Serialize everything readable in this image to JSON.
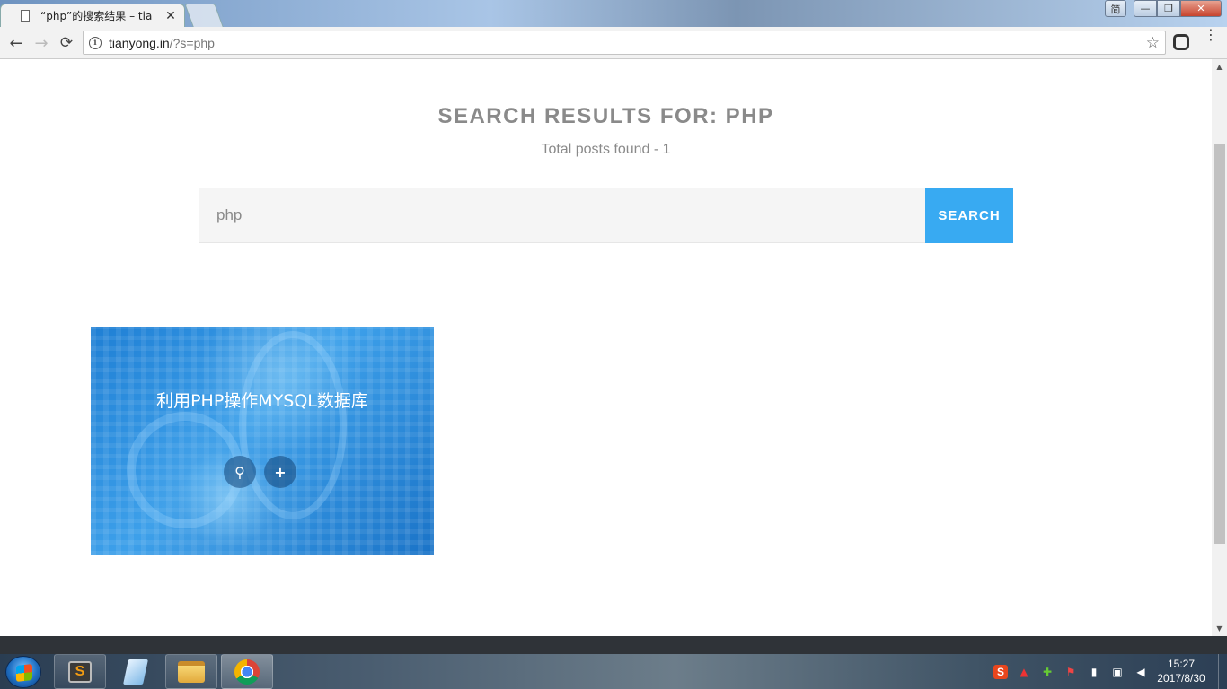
{
  "browser": {
    "tab_title": "“php”的搜索结果 – tia",
    "tab_close": "✕",
    "url_host": "tianyong.in",
    "url_path": "/?s=php",
    "back": "←",
    "forward": "→",
    "reload": "⟳",
    "star": "☆",
    "menu": "⋮",
    "ime": "简",
    "minimize": "—",
    "maximize": "❐",
    "close": "✕",
    "info": "i"
  },
  "page": {
    "heading": "SEARCH RESULTS FOR: PHP",
    "posts_found": "Total posts found - 1",
    "search_value": "php",
    "search_button": "SEARCH"
  },
  "post": {
    "title": "利用PHP操作MYSQL数据库",
    "view_icon": "search-icon",
    "more_icon": "plus-icon",
    "more_symbol": "+",
    "view_symbol": "⚲"
  },
  "taskbar": {
    "tray_sogou": "S",
    "time": "15:27",
    "date": "2017/8/30"
  },
  "scrollbar": {
    "up": "▲",
    "down": "▼"
  }
}
